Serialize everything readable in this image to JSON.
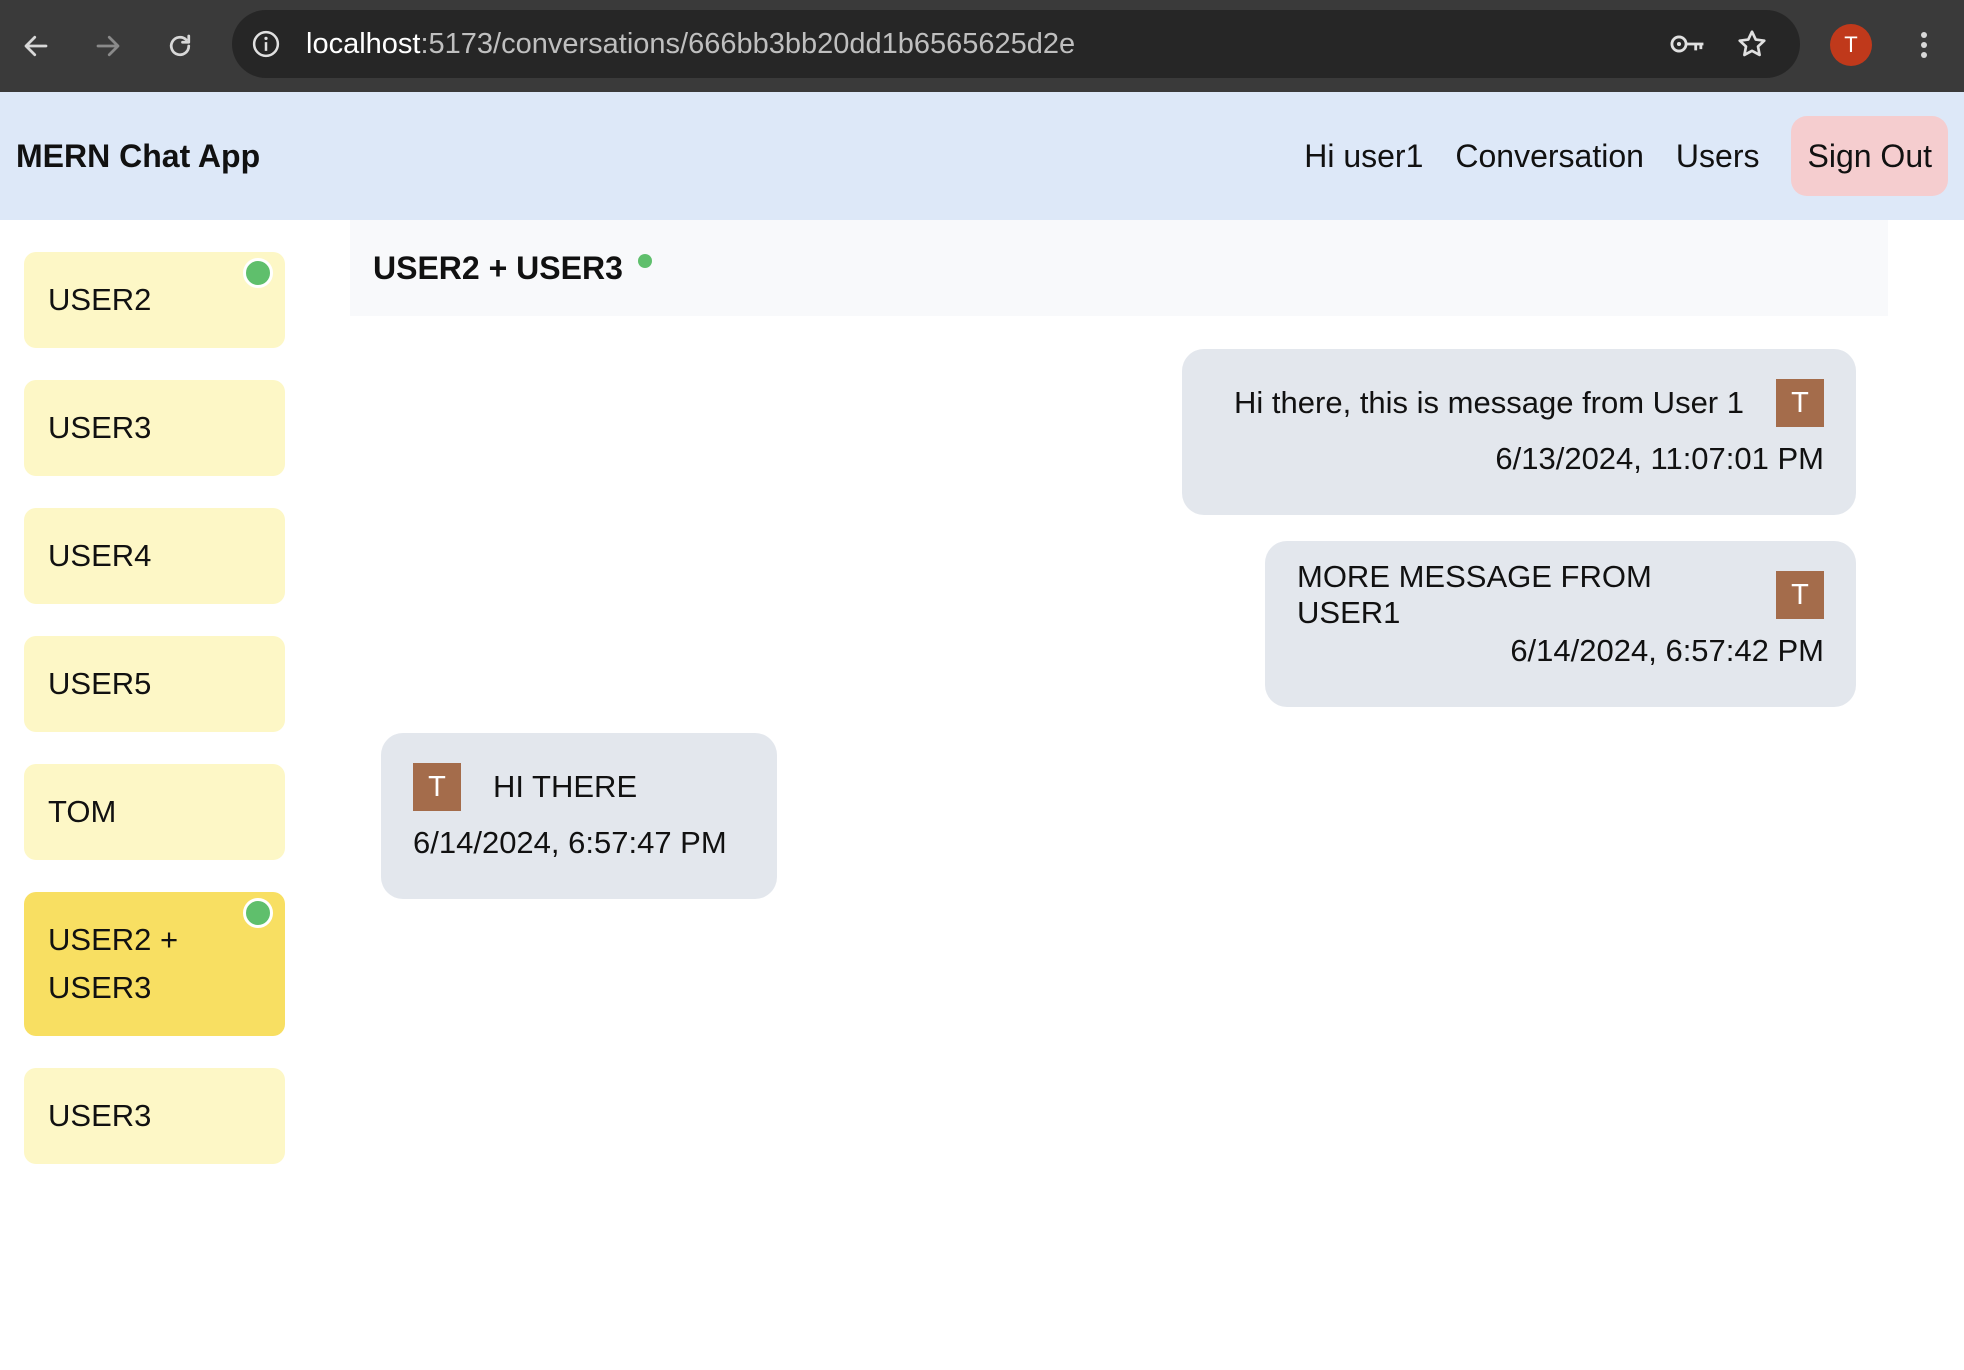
{
  "browser": {
    "url_host": "localhost",
    "url_path": ":5173/conversations/666bb3bb20dd1b6565625d2e",
    "profile_initial": "T",
    "icons": [
      "back-arrow-icon",
      "forward-arrow-icon",
      "reload-icon",
      "info-icon",
      "key-icon",
      "star-icon",
      "kebab-menu-icon"
    ]
  },
  "nav": {
    "brand": "MERN Chat App",
    "greeting": "Hi user1",
    "conversation_link": "Conversation",
    "users_link": "Users",
    "signout_label": "Sign Out"
  },
  "sidebar": {
    "items": [
      {
        "label": "USER2",
        "online": true,
        "active": false
      },
      {
        "label": "USER3",
        "online": false,
        "active": false
      },
      {
        "label": "USER4",
        "online": false,
        "active": false
      },
      {
        "label": "USER5",
        "online": false,
        "active": false
      },
      {
        "label": "TOM",
        "online": false,
        "active": false
      },
      {
        "label": "USER2 + USER3",
        "online": true,
        "active": true
      },
      {
        "label": "USER3",
        "online": false,
        "active": false
      }
    ]
  },
  "chat": {
    "title": "USER2 + USER3",
    "online": true,
    "messages": [
      {
        "text": "Hi there, this is message from User 1",
        "time": "6/13/2024, 11:07:01 PM",
        "avatar": "T",
        "mine": true
      },
      {
        "text": "MORE MESSAGE FROM USER1",
        "time": "6/14/2024, 6:57:42 PM",
        "avatar": "T",
        "mine": true
      },
      {
        "text": "HI THERE",
        "time": "6/14/2024, 6:57:47 PM",
        "avatar": "T",
        "mine": false
      }
    ]
  },
  "colors": {
    "nav_bg": "#dde8f8",
    "signout_bg": "#f5cdcf",
    "conv_item_bg": "#fdf7c6",
    "conv_item_active_bg": "#f8df62",
    "online": "#5fbf6c",
    "bubble_bg": "#e3e7ed",
    "avatar_bg": "#a46c4b"
  }
}
